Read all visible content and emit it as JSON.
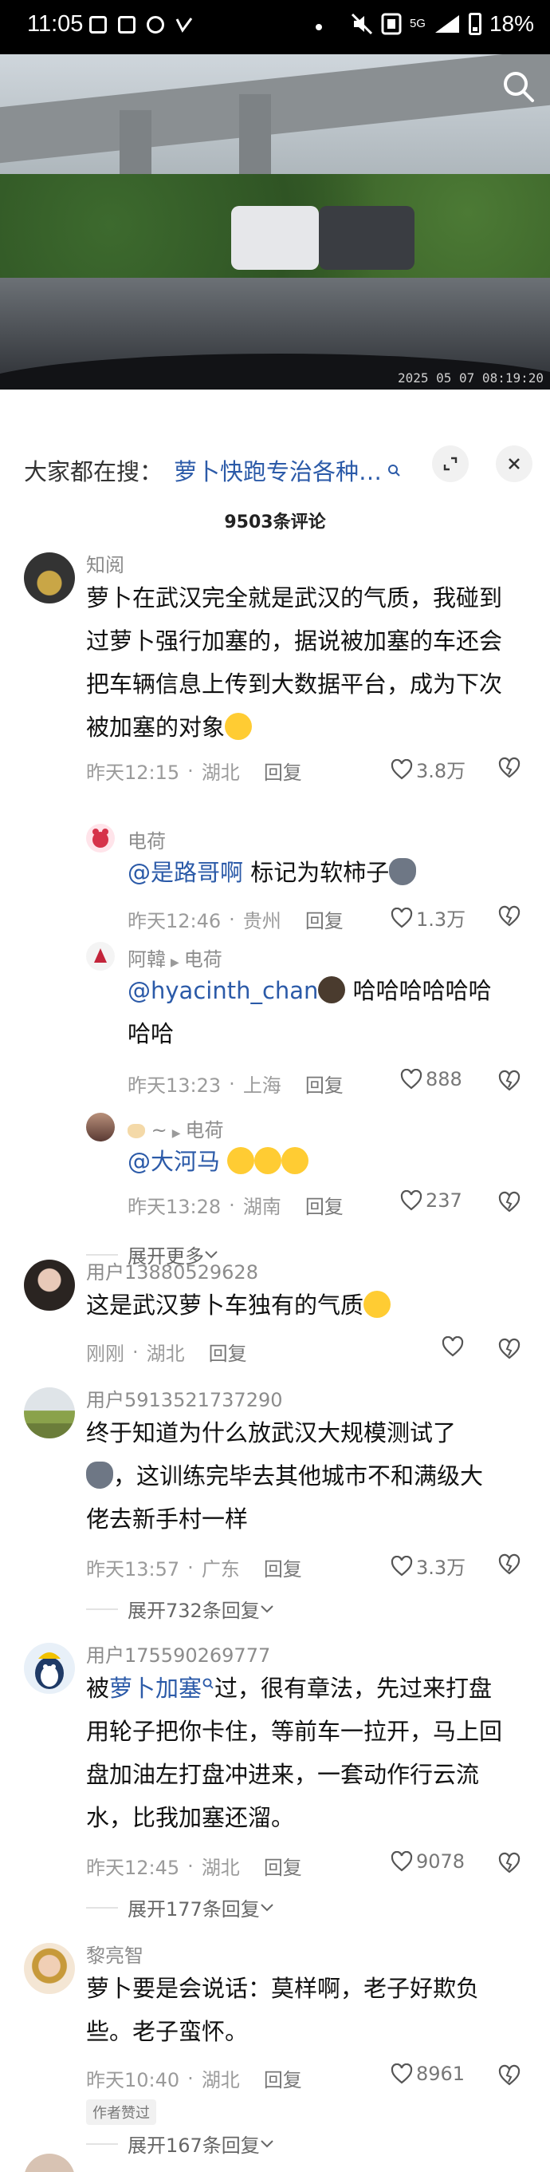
{
  "status_bar": {
    "time": "11:05",
    "network": "5G",
    "battery": "18%"
  },
  "video": {
    "timestamp": "2025 05 07 08:19:20"
  },
  "search": {
    "prefix": "大家都在搜：",
    "term": "萝卜快跑专治各种…"
  },
  "comments_header": {
    "title": "9503条评论"
  },
  "comments": [
    {
      "user": "知阅",
      "text": "萝卜在武汉完全就是武汉的气质，我碰到过萝卜强行加塞的，据说被加塞的车还会把车辆信息上传到大数据平台，成为下次被加塞的对象",
      "text_lines": [
        "萝卜在武汉完全就是武汉的气质，我碰到",
        "过萝卜强行加塞的，据说被加塞的车还会",
        "把车辆信息上传到大数据平台，成为下次",
        "被加塞的对象"
      ],
      "time": "昨天12:15",
      "location": "湖北",
      "reply": "回复",
      "likes": "3.8万",
      "replies": [
        {
          "user": "电荷",
          "mention": "@是路哥啊",
          "text": "标记为软柿子",
          "time": "昨天12:46",
          "location": "贵州",
          "reply": "回复",
          "likes": "1.3万"
        },
        {
          "user": "阿韓",
          "reply_to": "电荷",
          "mention": "@hyacinth_chan",
          "text": "哈哈哈哈哈哈",
          "text2": "哈哈",
          "time": "昨天13:23",
          "location": "上海",
          "reply": "回复",
          "likes": "888"
        },
        {
          "user": "~",
          "reply_to": "电荷",
          "mention": "@大河马",
          "time": "昨天13:28",
          "location": "湖南",
          "reply": "回复",
          "likes": "237"
        }
      ],
      "expand": "展开更多"
    },
    {
      "user": "用户13880529628",
      "text": "这是武汉萝卜车独有的气质",
      "time": "刚刚",
      "location": "湖北",
      "reply": "回复",
      "likes": ""
    },
    {
      "user": "用户5913521737290",
      "text_lines": [
        "终于知道为什么放武汉大规模测试了",
        "，这训练完毕去其他城市不和满级大",
        "佬去新手村一样"
      ],
      "time": "昨天13:57",
      "location": "广东",
      "reply": "回复",
      "likes": "3.3万",
      "expand": "展开732条回复"
    },
    {
      "user": "用户175590269777",
      "prefix": "被",
      "mention": "萝卜加塞",
      "text_lines": [
        "过，很有章法，先过来打盘",
        "用轮子把你卡住，等前车一拉开，马上回",
        "盘加油左打盘冲进来，一套动作行云流",
        "水，比我加塞还溜。"
      ],
      "time": "昨天12:45",
      "location": "湖北",
      "reply": "回复",
      "likes": "9078",
      "expand": "展开177条回复"
    },
    {
      "user": "黎亮智",
      "text_lines": [
        "萝卜要是会说话：莫样啊，老子好欺负",
        "些。老子蛮怀。"
      ],
      "time": "昨天10:40",
      "location": "湖北",
      "reply": "回复",
      "likes": "8961",
      "badge": "作者赞过",
      "expand": "展开167条回复"
    }
  ],
  "colors": {
    "mention": "#2b5aa8",
    "meta": "#9b9b9b"
  }
}
